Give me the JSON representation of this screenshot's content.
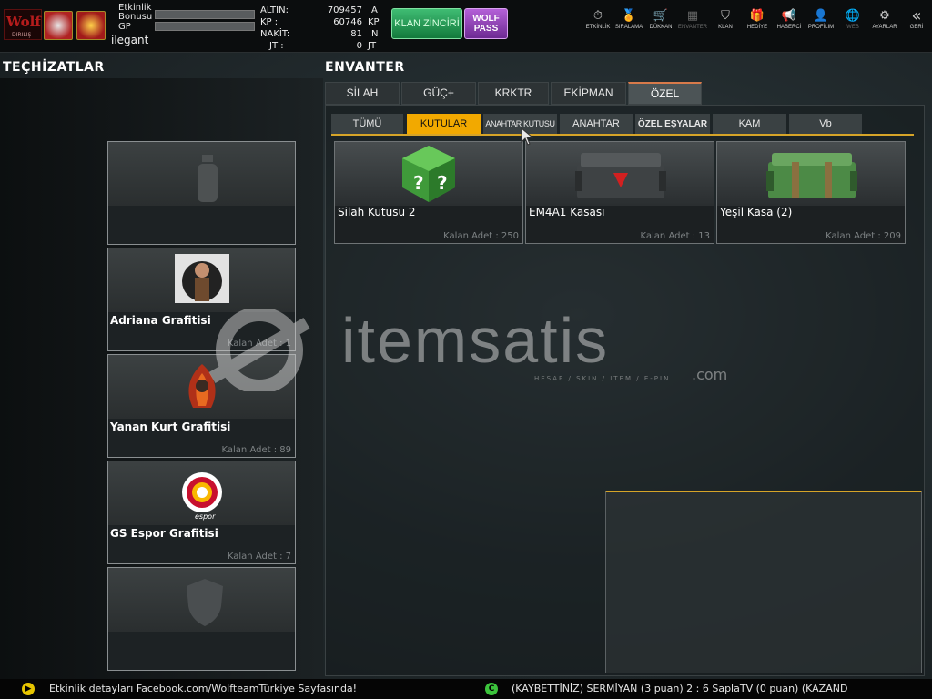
{
  "topbar": {
    "logo_text": "Wolf",
    "logo_sub": "DIRILIŞ",
    "etkinlik_label": "Etkinlik Bonusu",
    "gp_label": "GP",
    "username": "ilegant",
    "currency": [
      {
        "label": "ALTIN:",
        "value": "709457",
        "unit": "A"
      },
      {
        "label": "KP :",
        "value": "60746",
        "unit": "KP"
      },
      {
        "label": "NAKİT:",
        "value": "81",
        "unit": "N"
      },
      {
        "label": "JT :",
        "value": "0",
        "unit": "JT"
      }
    ],
    "klan_zinciri": "KLAN ZİNCİRİ",
    "wolf_pass_1": "WOLF",
    "wolf_pass_2": "PASS",
    "nav": [
      {
        "icon": "stopwatch-icon",
        "glyph": "⏱",
        "label": "ETKİNLİK",
        "enabled": true
      },
      {
        "icon": "medal-icon",
        "glyph": "🏅",
        "label": "SIRALAMA",
        "enabled": true
      },
      {
        "icon": "cart-icon",
        "glyph": "🛒",
        "label": "DÜKKAN",
        "enabled": true
      },
      {
        "icon": "inventory-icon",
        "glyph": "▦",
        "label": "ENVANTER",
        "enabled": false
      },
      {
        "icon": "shield-icon",
        "glyph": "⛉",
        "label": "KLAN",
        "enabled": true
      },
      {
        "icon": "gift-icon",
        "glyph": "🎁",
        "label": "HEDİYE",
        "enabled": true
      },
      {
        "icon": "megaphone-icon",
        "glyph": "📢",
        "label": "HABERCİ",
        "enabled": true
      },
      {
        "icon": "profile-icon",
        "glyph": "👤",
        "label": "PROFİLIM",
        "enabled": true
      },
      {
        "icon": "globe-icon",
        "glyph": "🌐",
        "label": "WEB",
        "enabled": false
      },
      {
        "icon": "gear-icon",
        "glyph": "⚙",
        "label": "AYARLAR",
        "enabled": true
      },
      {
        "icon": "back-icon",
        "glyph": "«",
        "label": "GERİ",
        "enabled": true
      }
    ]
  },
  "left": {
    "title": "TEÇHİZATLAR",
    "slots": [
      {
        "name": "",
        "count": "",
        "placeholder": "spray-can-icon"
      },
      {
        "name": "Adriana Grafitisi",
        "count": "Kalan Adet : 1"
      },
      {
        "name": "Yanan Kurt Grafitisi",
        "count": "Kalan Adet : 89"
      },
      {
        "name": "GS Espor Grafitisi",
        "count": "Kalan Adet : 7",
        "logo_text": "espor"
      },
      {
        "name": "",
        "count": "",
        "placeholder": "shield-icon"
      }
    ]
  },
  "center": {
    "title": "ENVANTER",
    "main_tabs": [
      "SİLAH",
      "GÜÇ+",
      "KRKTR",
      "EKİPMAN",
      "ÖZEL"
    ],
    "active_main_tab": 4,
    "sub_tabs": [
      "TÜMÜ",
      "KUTULAR",
      "ANAHTAR KUTUSU",
      "ANAHTAR",
      "ÖZEL EŞYALAR",
      "KAM",
      "Vb"
    ],
    "active_sub_tab": 1,
    "items": [
      {
        "name": "Silah Kutusu 2",
        "count": "Kalan Adet : 250"
      },
      {
        "name": "EM4A1 Kasası",
        "count": "Kalan Adet : 13"
      },
      {
        "name": "Yeşil Kasa (2)",
        "count": "Kalan Adet : 209"
      }
    ]
  },
  "watermark": {
    "brand": "itemsatis",
    "suffix": ".com",
    "tagline": "HESAP / SKIN / ITEM / E-PIN"
  },
  "bottom": {
    "left_text": "Etkinlik detayları Facebook.com/WolfteamTürkiye Sayfasında!",
    "right_text": "(KAYBETTİNİZ) SERMİYAN (3 puan) 2 : 6 SaplaTV (0 puan) (KAZAND"
  },
  "colors": {
    "accent": "#f2a900",
    "klan": "#2aa35a",
    "wolfpass": "#9b48c2",
    "active_tab_line": "#d87a4a"
  }
}
